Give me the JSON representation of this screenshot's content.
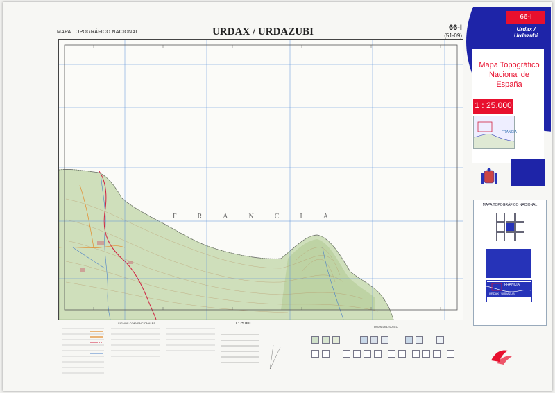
{
  "header": {
    "series_label": "MAPA TOPOGRÁFICO NACIONAL",
    "sheet_title": "URDAX / URDAZUBI",
    "sheet_number": "66-I",
    "sheet_code": "(51-09)"
  },
  "map": {
    "country_label": "FRANCIA"
  },
  "cover": {
    "sheet_number": "66-I",
    "name_line1": "Urdax /",
    "name_line2": "Urdazubi",
    "title_line1": "Mapa Topográfico",
    "title_line2": "Nacional de",
    "title_line3": "España",
    "scale": "1 : 25.000",
    "inset_label": "FRANCIA"
  },
  "info_panel": {
    "title": "MAPA TOPOGRÁFICO NACIONAL",
    "inset_label": "FRANCIA",
    "inset_sheet": "URDAX / URDAZUBI"
  },
  "legend": {
    "heading": "SIGNOS CONVENCIONALES",
    "scale": "1 : 25.000"
  },
  "land_use": {
    "heading": "USOS DEL SUELO"
  },
  "colors": {
    "cover_red": "#e8102e",
    "cover_blue": "#1e24a8",
    "grid_blue": "#5a8fd8",
    "terrain_green": "#c9dcb4",
    "contour_brown": "#b48a5a",
    "border_red": "#d02040"
  }
}
